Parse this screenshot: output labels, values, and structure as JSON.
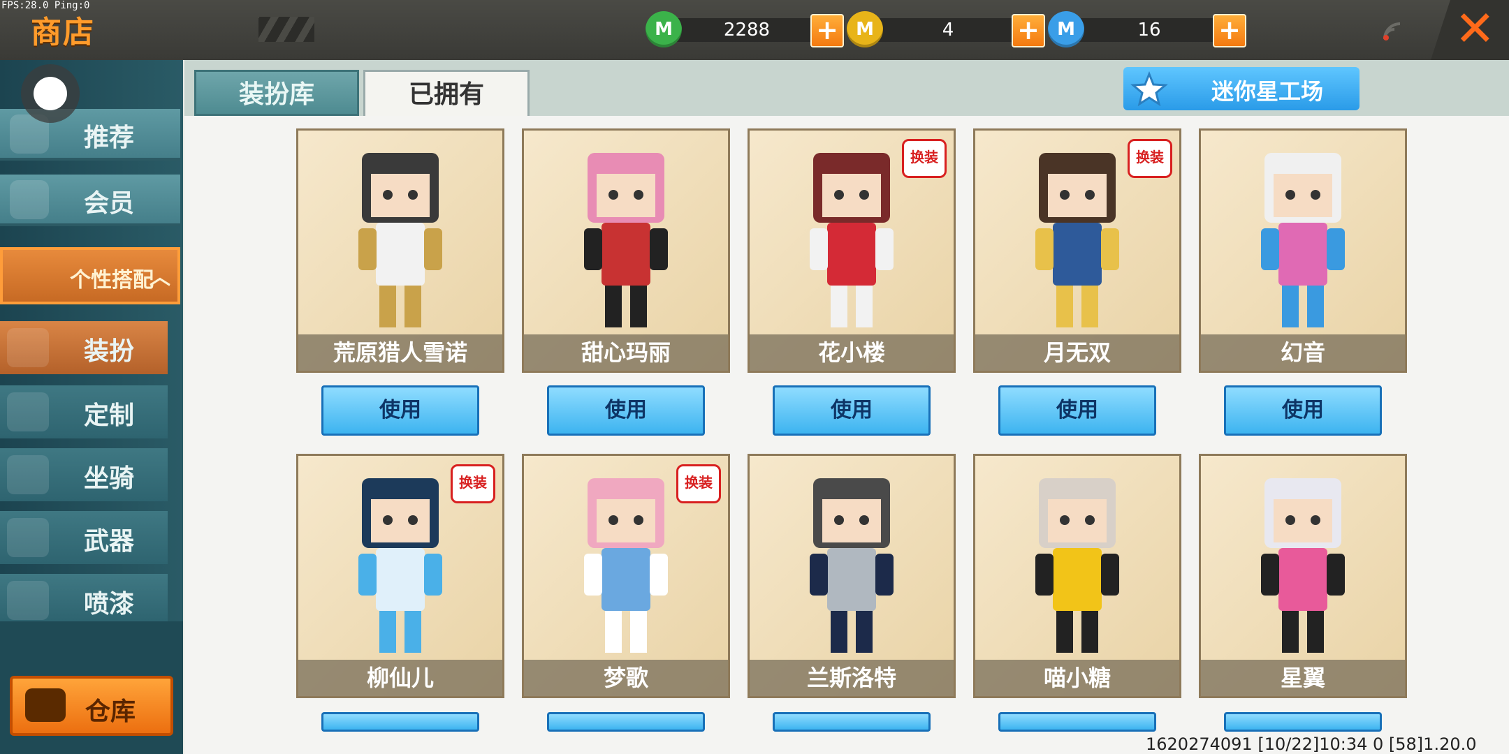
{
  "debug": "FPS:28.0  Ping:0",
  "header": {
    "title": "商店"
  },
  "currencies": [
    {
      "icon": "green-gem-icon",
      "symbol": "M",
      "value": "2288",
      "color": "#3bb24a"
    },
    {
      "icon": "gold-coin-icon",
      "symbol": "M",
      "value": "4",
      "color": "#e8b419"
    },
    {
      "icon": "blue-star-coin-icon",
      "symbol": "M",
      "value": "16",
      "color": "#3a9ee8"
    }
  ],
  "sidebar": {
    "items": [
      {
        "label": "推荐"
      },
      {
        "label": "会员"
      }
    ],
    "personal": "个性搭配",
    "sub": [
      {
        "label": "装扮",
        "active": true
      },
      {
        "label": "定制"
      },
      {
        "label": "坐骑"
      },
      {
        "label": "武器"
      },
      {
        "label": "喷漆"
      }
    ],
    "storage": "仓库"
  },
  "tabs": [
    {
      "label": "装扮库"
    },
    {
      "label": "已拥有"
    }
  ],
  "workshop_button": "迷你星工场",
  "use_label": "使用",
  "badge_label": "换装",
  "cards": [
    {
      "name": "荒原猎人雪诺",
      "badge": false,
      "colors": [
        "#3a3a3a",
        "#f2f2f2",
        "#c9a24a"
      ]
    },
    {
      "name": "甜心玛丽",
      "badge": false,
      "colors": [
        "#e88cb4",
        "#c83232",
        "#222"
      ]
    },
    {
      "name": "花小楼",
      "badge": true,
      "colors": [
        "#7a2a2a",
        "#d42a36",
        "#f2f2f2"
      ]
    },
    {
      "name": "月无双",
      "badge": true,
      "colors": [
        "#4a3426",
        "#2e5a9a",
        "#e8c14a"
      ]
    },
    {
      "name": "幻音",
      "badge": false,
      "colors": [
        "#f0f0f0",
        "#e06ab4",
        "#3a9ae0"
      ]
    },
    {
      "name": "柳仙儿",
      "badge": true,
      "colors": [
        "#1c3a5a",
        "#e0f0fa",
        "#4ab0e8"
      ]
    },
    {
      "name": "梦歌",
      "badge": true,
      "colors": [
        "#f0a8c0",
        "#6aa8e0",
        "#ffffff"
      ]
    },
    {
      "name": "兰斯洛特",
      "badge": false,
      "colors": [
        "#4a4a4a",
        "#b0b8c0",
        "#1c2a4a"
      ]
    },
    {
      "name": "喵小糖",
      "badge": false,
      "colors": [
        "#d8d0c8",
        "#f2c418",
        "#222"
      ]
    },
    {
      "name": "星翼",
      "badge": false,
      "colors": [
        "#e8e8f0",
        "#e85a9a",
        "#222"
      ]
    }
  ],
  "status_bar": "1620274091   [10/22]10:34 0   [58]1.20.0"
}
